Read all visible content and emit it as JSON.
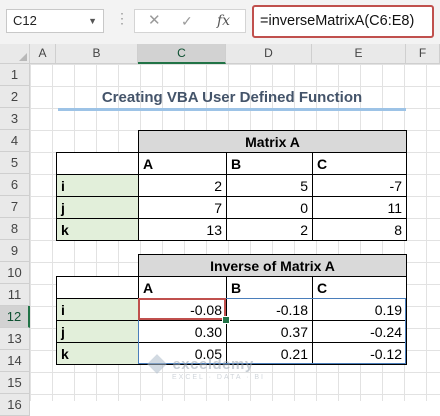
{
  "formula_bar": {
    "name_box": "C12",
    "dropdown_glyph": "▼",
    "more_glyph": "⋮",
    "cancel_glyph": "✕",
    "enter_glyph": "✓",
    "fx_label": "fx",
    "formula": "=inverseMatrixA(C6:E8)"
  },
  "columns": [
    "A",
    "B",
    "C",
    "D",
    "E",
    "F"
  ],
  "rows": [
    "1",
    "2",
    "3",
    "4",
    "5",
    "6",
    "7",
    "8",
    "9",
    "10",
    "11",
    "12",
    "13",
    "14",
    "15",
    "16"
  ],
  "active_cell": {
    "column": "C",
    "row": "12"
  },
  "sheet_title": "Creating VBA User Defined Function",
  "matrix_a": {
    "title": "Matrix A",
    "headers": [
      "A",
      "B",
      "C"
    ],
    "rows": [
      {
        "label": "i",
        "values": [
          "2",
          "5",
          "-7"
        ]
      },
      {
        "label": "j",
        "values": [
          "7",
          "0",
          "11"
        ]
      },
      {
        "label": "k",
        "values": [
          "13",
          "2",
          "8"
        ]
      }
    ]
  },
  "inverse_matrix": {
    "title": "Inverse of Matrix A",
    "headers": [
      "A",
      "B",
      "C"
    ],
    "rows": [
      {
        "label": "i",
        "values": [
          "-0.08",
          "-0.18",
          "0.19"
        ]
      },
      {
        "label": "j",
        "values": [
          "0.30",
          "0.37",
          "-0.24"
        ]
      },
      {
        "label": "k",
        "values": [
          "0.05",
          "0.21",
          "-0.12"
        ]
      }
    ]
  },
  "watermark": {
    "name": "exceldemy",
    "tagline": "EXCEL · DATA · BI"
  },
  "colors": {
    "accent_green": "#217346",
    "selection_red": "#c0504d",
    "title_color": "#44546a",
    "row_label_fill": "#e2efda",
    "table_title_fill": "#d9d9d9"
  }
}
